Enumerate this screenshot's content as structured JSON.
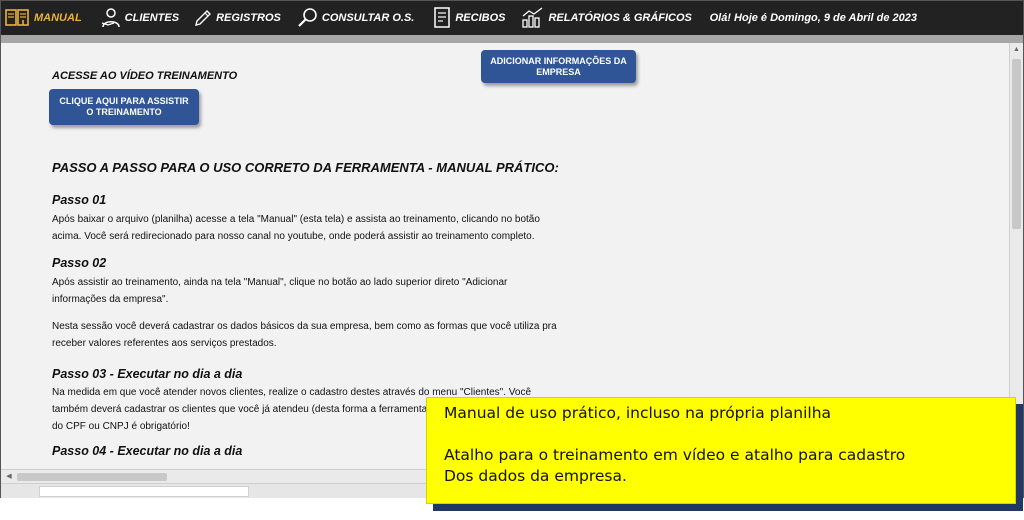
{
  "nav": {
    "items": [
      {
        "label": "MANUAL",
        "icon": "manual-icon"
      },
      {
        "label": "CLIENTES",
        "icon": "clients-icon"
      },
      {
        "label": "REGISTROS",
        "icon": "pencil-icon"
      },
      {
        "label": "CONSULTAR O.S.",
        "icon": "search-icon"
      },
      {
        "label": "RECIBOS",
        "icon": "document-icon"
      },
      {
        "label": "RELATÓRIOS & GRÁFICOS",
        "icon": "chart-icon"
      }
    ],
    "greeting": "Olá! Hoje é Domingo, 9 de Abril de 2023"
  },
  "colors": {
    "topbar": "#222222",
    "active_nav": "#e8b33a",
    "button": "#2f5597",
    "callout_bg": "#ffff00",
    "callout_shadow": "#1f3864"
  },
  "buttons": {
    "company_info": "ADICIONAR INFORMAÇÕES DA EMPRESA",
    "training": "CLIQUE AQUI PARA ASSISTIR O TREINAMENTO"
  },
  "content": {
    "acesse": "ACESSE  AO VÍDEO TREINAMENTO",
    "main_title": "PASSO A PASSO PARA O USO CORRETO DA FERRAMENTA - MANUAL PRÁTICO:",
    "steps": [
      {
        "title": "Passo 01",
        "lines": [
          "Após baixar o arquivo (planilha) acesse a tela \"Manual\" (esta tela) e assista ao treinamento, clicando no botão",
          "acima. Você será redirecionado para nosso canal no youtube, onde poderá assistir ao treinamento completo."
        ]
      },
      {
        "title": "Passo 02",
        "lines": [
          "Após assistir ao treinamento, ainda na tela \"Manual\", clique no botão ao lado superior direto \"Adicionar",
          "informações da empresa\"."
        ],
        "lines2": [
          "Nesta sessão você deverá cadastrar os dados básicos da sua empresa, bem  como as formas que você utiliza pra",
          "receber valores referentes aos serviços prestados."
        ]
      },
      {
        "title": "Passo 03 - Executar no dia a dia",
        "lines": [
          "Na medida em que você atender novos clientes, realize o cadastro destes através do menu \"Clientes\". Você",
          "também deverá cadastrar os clientes que você já atendeu (desta forma a ferramenta",
          "do CPF ou CNPJ é obrigatório!"
        ]
      },
      {
        "title": "Passo 04 - Executar no dia a dia"
      }
    ]
  },
  "callout": {
    "line1": "Manual de uso prático, incluso na própria planilha",
    "line2": "Atalho  para o treinamento em vídeo e atalho para cadastro",
    "line3": "Dos dados da empresa."
  }
}
